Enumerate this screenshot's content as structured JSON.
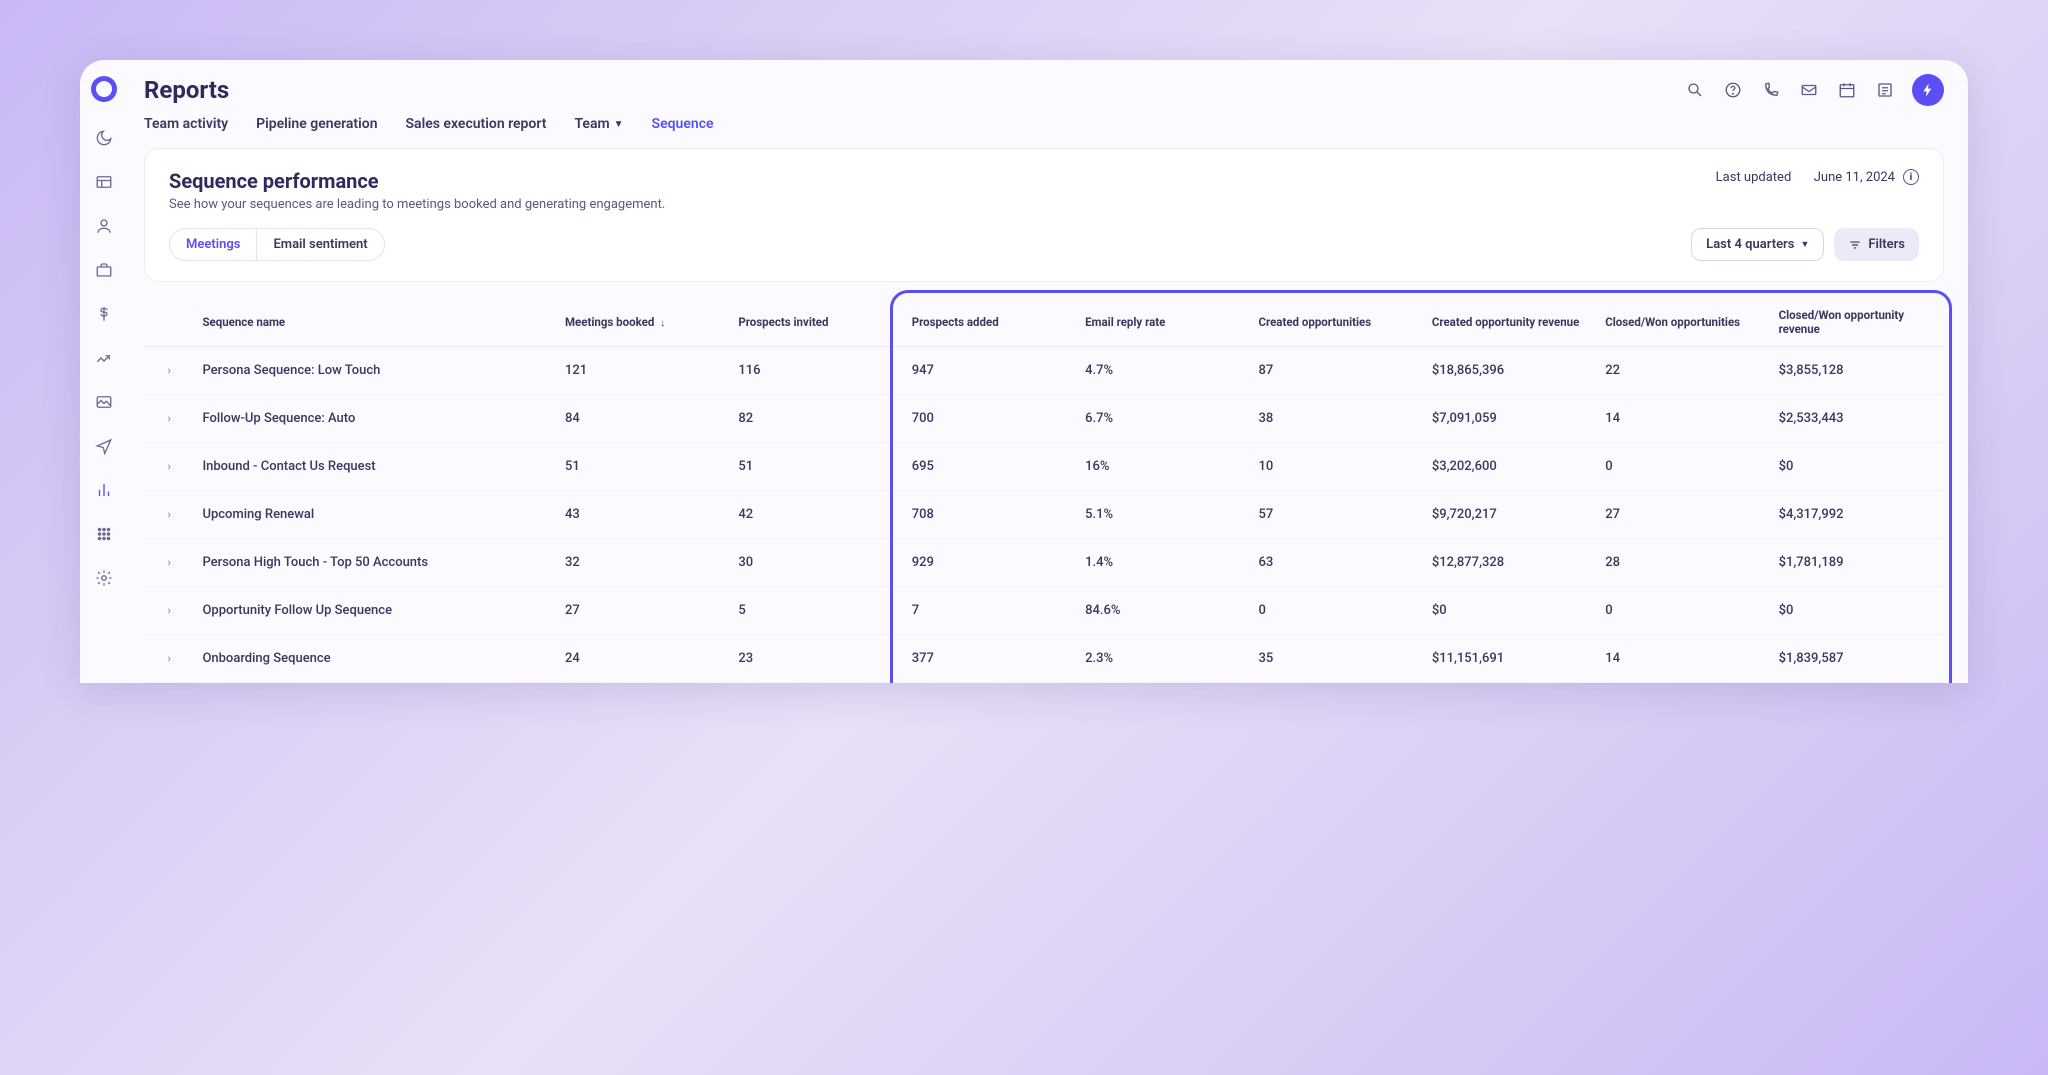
{
  "page_title": "Reports",
  "tabs": [
    "Team activity",
    "Pipeline generation",
    "Sales execution report",
    "Team",
    "Sequence"
  ],
  "active_tab_index": 4,
  "card": {
    "title": "Sequence performance",
    "subtitle": "See how your sequences are leading to meetings booked and generating engagement.",
    "last_updated_label": "Last updated",
    "last_updated_date": "June 11, 2024"
  },
  "segmented": {
    "meetings": "Meetings",
    "email_sentiment": "Email sentiment"
  },
  "controls": {
    "date_range": "Last 4 quarters",
    "filters": "Filters"
  },
  "columns": {
    "sequence_name": "Sequence name",
    "meetings_booked": "Meetings booked",
    "prospects_invited": "Prospects invited",
    "prospects_added": "Prospects added",
    "email_reply_rate": "Email reply rate",
    "created_opportunities": "Created opportunities",
    "created_opportunity_revenue": "Created opportunity revenue",
    "closed_won_opportunities": "Closed/Won opportunities",
    "closed_won_opportunity_revenue": "Closed/Won opportunity revenue"
  },
  "rows": [
    {
      "name": "Persona Sequence: Low Touch",
      "meetings": "121",
      "invited": "116",
      "added": "947",
      "reply": "4.7%",
      "created_opp": "87",
      "created_rev": "$18,865,396",
      "won_opp": "22",
      "won_rev": "$3,855,128"
    },
    {
      "name": "Follow-Up Sequence: Auto",
      "meetings": "84",
      "invited": "82",
      "added": "700",
      "reply": "6.7%",
      "created_opp": "38",
      "created_rev": "$7,091,059",
      "won_opp": "14",
      "won_rev": "$2,533,443"
    },
    {
      "name": "Inbound - Contact Us Request",
      "meetings": "51",
      "invited": "51",
      "added": "695",
      "reply": "16%",
      "created_opp": "10",
      "created_rev": "$3,202,600",
      "won_opp": "0",
      "won_rev": "$0"
    },
    {
      "name": "Upcoming Renewal",
      "meetings": "43",
      "invited": "42",
      "added": "708",
      "reply": "5.1%",
      "created_opp": "57",
      "created_rev": "$9,720,217",
      "won_opp": "27",
      "won_rev": "$4,317,992"
    },
    {
      "name": "Persona High Touch - Top 50 Accounts",
      "meetings": "32",
      "invited": "30",
      "added": "929",
      "reply": "1.4%",
      "created_opp": "63",
      "created_rev": "$12,877,328",
      "won_opp": "28",
      "won_rev": "$1,781,189"
    },
    {
      "name": "Opportunity Follow Up Sequence",
      "meetings": "27",
      "invited": "5",
      "added": "7",
      "reply": "84.6%",
      "created_opp": "0",
      "created_rev": "$0",
      "won_opp": "0",
      "won_rev": "$0"
    },
    {
      "name": "Onboarding Sequence",
      "meetings": "24",
      "invited": "23",
      "added": "377",
      "reply": "2.3%",
      "created_opp": "35",
      "created_rev": "$11,151,691",
      "won_opp": "14",
      "won_rev": "$1,839,587"
    }
  ]
}
